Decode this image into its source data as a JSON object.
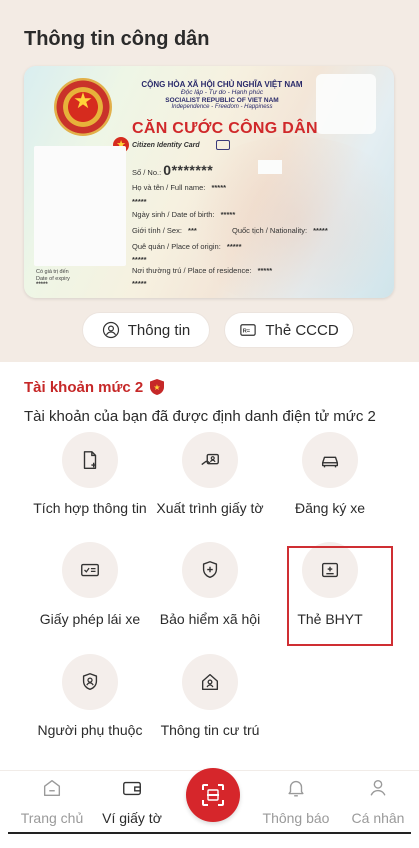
{
  "page_title": "Thông tin công dân",
  "id_card": {
    "header_line1": "CỘNG HÒA XÃ HỘI CHỦ NGHĨA VIỆT NAM",
    "header_line2": "Độc lập - Tự do - Hạnh phúc",
    "header_line3": "SOCIALIST REPUBLIC OF VIET NAM",
    "header_line4": "Independence - Freedom - Happiness",
    "title": "CĂN CƯỚC CÔNG DÂN",
    "subtitle": "Citizen Identity Card",
    "no_label": "Số / No.:",
    "no_value": "0*******",
    "name_label": "Họ và tên / Full name:",
    "name_value": "*****",
    "name_value_2": "*****",
    "dob_label": "Ngày sinh / Date of birth:",
    "dob_value": "*****",
    "sex_label": "Giới tính / Sex:",
    "sex_value": "***",
    "nationality_label": "Quốc tịch / Nationality:",
    "nationality_value": "*****",
    "origin_label": "Quê quán / Place of origin:",
    "origin_value": "*****",
    "origin_value_2": "*****",
    "residence_label": "Nơi thường trú / Place of residence:",
    "residence_value": "*****",
    "residence_value_2": "*****",
    "expiry_label": "Có giá trị đến",
    "expiry_label_en": "Date of expiry",
    "expiry_value": "*****"
  },
  "buttons": {
    "info": "Thông tin",
    "cccd": "Thẻ CCCD"
  },
  "account": {
    "title": "Tài khoản mức 2",
    "description": "Tài khoản của bạn đã được định danh điện tử mức 2"
  },
  "tiles": [
    {
      "label": "Tích hợp thông tin",
      "icon": "document-add-icon"
    },
    {
      "label": "Xuất trình giấy tờ",
      "icon": "card-present-icon"
    },
    {
      "label": "Đăng ký xe",
      "icon": "car-icon"
    },
    {
      "label": "Giấy phép lái xe",
      "icon": "license-icon"
    },
    {
      "label": "Bảo hiểm xã hội",
      "icon": "shield-plus-icon"
    },
    {
      "label": "Thẻ BHYT",
      "icon": "health-card-icon"
    },
    {
      "label": "Người phụ thuộc",
      "icon": "dependent-icon"
    },
    {
      "label": "Thông tin cư trú",
      "icon": "home-user-icon"
    }
  ],
  "nav": {
    "home": "Trang chủ",
    "wallet": "Ví giấy tờ",
    "notifications": "Thông báo",
    "profile": "Cá nhân"
  },
  "colors": {
    "accent_red": "#d6262b",
    "highlight_border": "#cf2e33",
    "header_bg": "#f3ebe4"
  }
}
